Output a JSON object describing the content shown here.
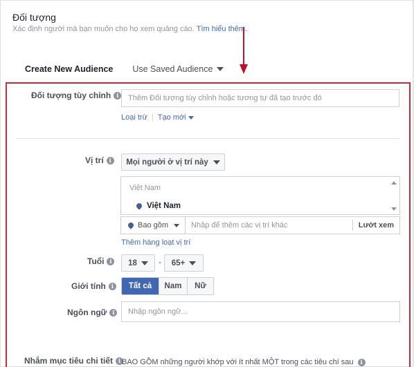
{
  "header": {
    "title": "Đối tượng",
    "subtitle": "Xác định người mà bạn muốn cho họ xem quảng cáo.",
    "learn_more": "Tìm hiểu thêm."
  },
  "audience_tabs": {
    "create_new": "Create New Audience",
    "use_saved": "Use Saved Audience"
  },
  "custom_audience": {
    "label": "Đối tượng tùy chỉnh",
    "placeholder": "Thêm Đối tượng tùy chỉnh hoặc tương tự đã tạo trước đó",
    "exclude_link": "Loại trừ",
    "separator": "|",
    "create_new_link": "Tạo mới"
  },
  "location": {
    "label": "Vị trí",
    "scope_dropdown": "Mọi người ở vị trí này",
    "list_header": "Việt Nam",
    "selected_item": "Việt Nam",
    "include_selector": "Bao gồm",
    "search_placeholder": "Nhập để thêm các vị trí khác",
    "browse": "Lướt xem",
    "bulk_add_link": "Thêm hàng loạt vị trí"
  },
  "age": {
    "label": "Tuổi",
    "min": "18",
    "separator": "-",
    "max": "65+"
  },
  "gender": {
    "label": "Giới tính",
    "options": [
      "Tất cả",
      "Nam",
      "Nữ"
    ],
    "selected": "Tất cả"
  },
  "language": {
    "label": "Ngôn ngữ",
    "placeholder": "Nhập ngôn ngữ..."
  },
  "detailed_targeting": {
    "label": "Nhắm mục tiêu chi tiết",
    "description": "BAO GỒM những người khớp với ít nhất MỘT trong các tiêu chí sau"
  },
  "icons": {
    "info": "i"
  },
  "colors": {
    "accent": "#4267b2",
    "annotation_red": "#c82a3a"
  }
}
